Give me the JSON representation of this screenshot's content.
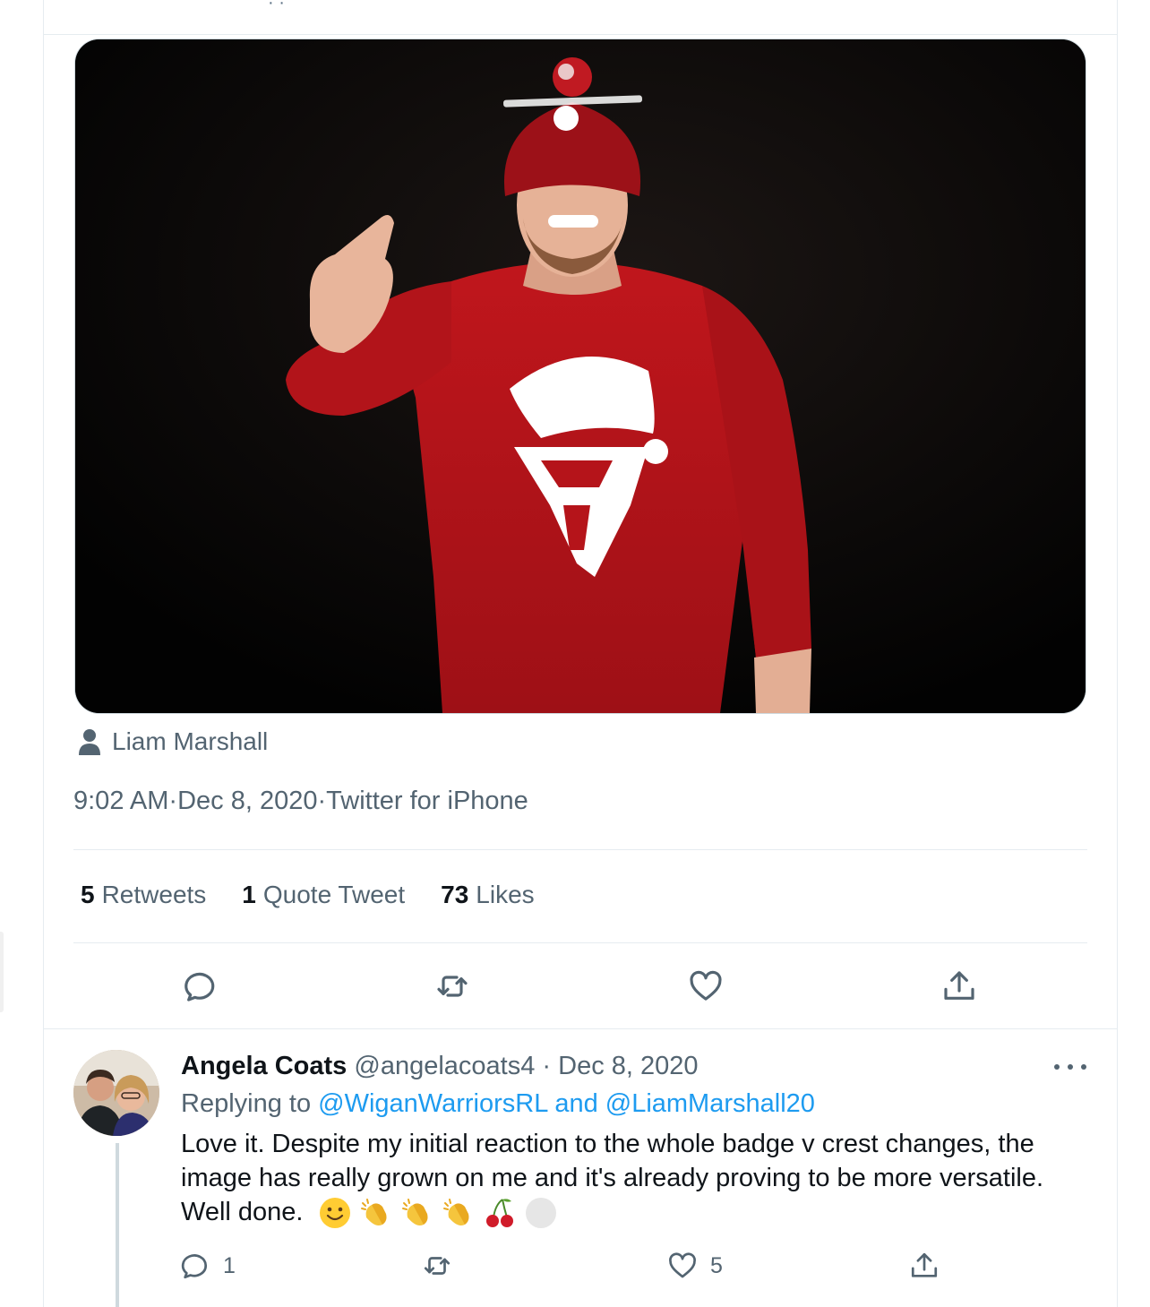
{
  "tweet": {
    "tagged_user": "Liam Marshall",
    "time": "9:02 AM",
    "date": "Dec 8, 2020",
    "source": "Twitter for iPhone",
    "separator": " · ",
    "stats": {
      "retweets_count": "5",
      "retweets_label": "Retweets",
      "quotes_count": "1",
      "quotes_label": "Quote Tweet",
      "likes_count": "73",
      "likes_label": "Likes"
    },
    "icons": [
      "reply-icon",
      "retweet-icon",
      "like-icon",
      "share-icon"
    ]
  },
  "reply": {
    "name": "Angela Coats",
    "handle": "@angelacoats4",
    "separator": " · ",
    "date": "Dec 8, 2020",
    "replying_prefix": "Replying to ",
    "replying_user1": "@WiganWarriorsRL",
    "replying_and": " and ",
    "replying_user2": "@LiamMarshall20",
    "text": "Love it. Despite my initial reaction to the whole badge v crest changes, the image has really grown on me and it's already proving to be more versatile. Well done.",
    "emojis": [
      "slightly-smiling-face",
      "clapping-hands",
      "clapping-hands",
      "clapping-hands",
      "cherries",
      "white-circle"
    ],
    "reply_count": "1",
    "retweet_count": "",
    "like_count": "5"
  },
  "colors": {
    "text_primary": "#0f1419",
    "text_secondary": "#536471",
    "link": "#1d9bf0",
    "border": "#e6ecf0",
    "jumper_red": "#b5141a"
  }
}
